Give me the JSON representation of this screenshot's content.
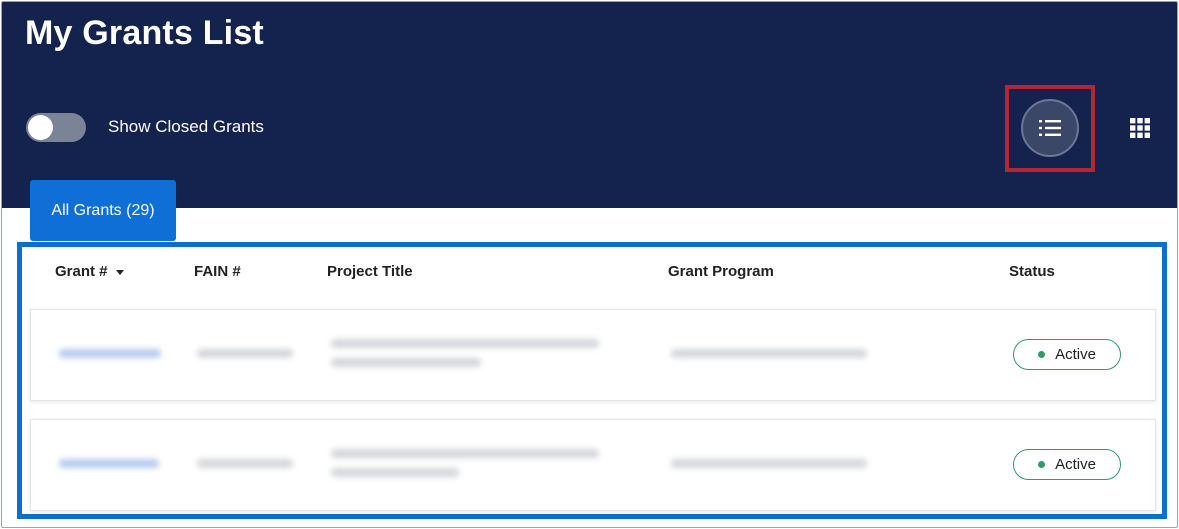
{
  "header": {
    "title": "My Grants List",
    "toggle_label": "Show Closed Grants",
    "toggle_on": false
  },
  "view_controls": {
    "list_view_icon": "list-icon",
    "grid_view_icon": "grid-icon"
  },
  "tabs": [
    {
      "label": "All Grants (29)",
      "active": true
    }
  ],
  "table": {
    "columns": [
      "Grant #",
      "FAIN #",
      "Project Title",
      "Grant Program",
      "Status"
    ],
    "rows": [
      {
        "status": "Active"
      },
      {
        "status": "Active"
      }
    ]
  },
  "colors": {
    "header_bg": "#13234d",
    "tab_bg": "#0f6fd6",
    "highlight_red": "#b02832",
    "highlight_blue": "#0c6fce",
    "status_green": "#2e9b6b"
  }
}
